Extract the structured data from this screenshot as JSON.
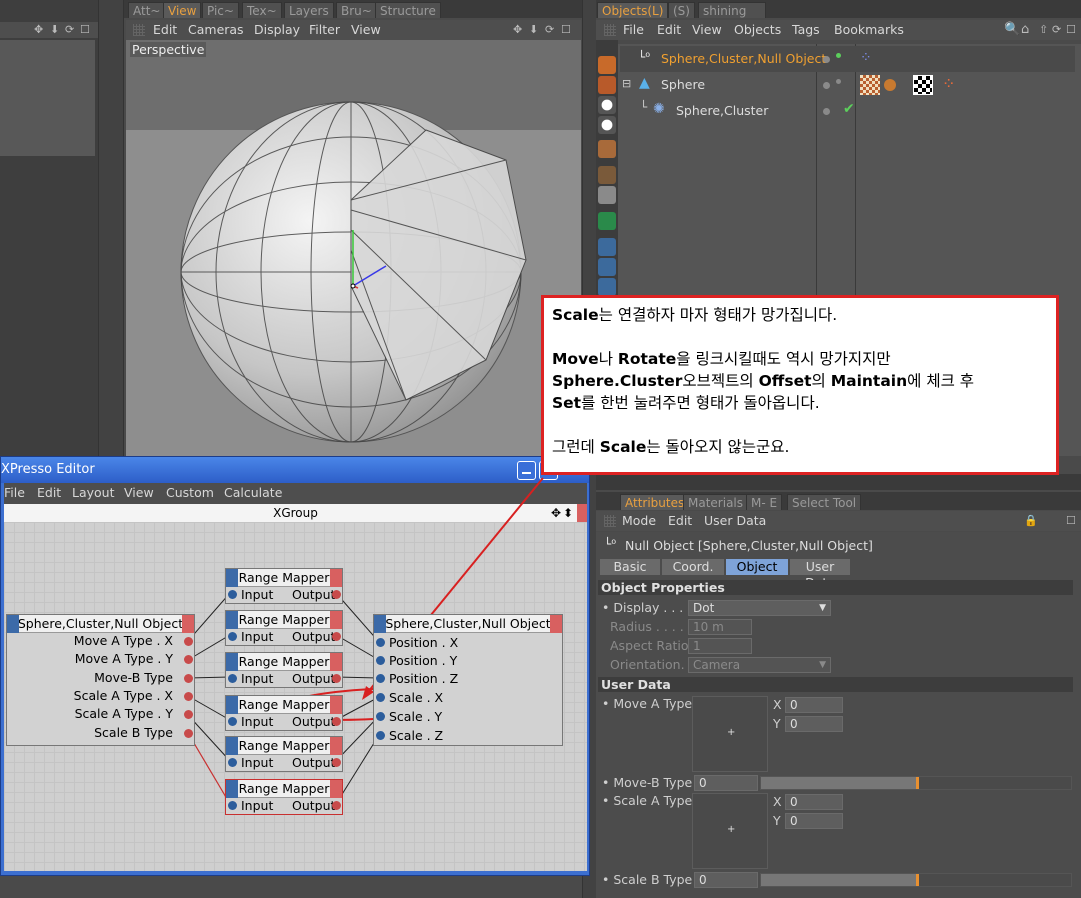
{
  "left_panel": {
    "tabs": [
      "Att~",
      "View",
      "Pic~",
      "Tex~",
      "Layers",
      "Bru~",
      "Structure"
    ],
    "active_tab": "View"
  },
  "viewport": {
    "menus": [
      "Edit",
      "Cameras",
      "Display",
      "Filter",
      "View"
    ],
    "label": "Perspective"
  },
  "object_manager": {
    "tabs": [
      "Objects(L)",
      "(S)",
      "shining"
    ],
    "menus": [
      "File",
      "Edit",
      "View",
      "Objects",
      "Tags",
      "Bookmarks"
    ],
    "objects": [
      {
        "name": "Sphere,Cluster,Null Object",
        "selected": true
      },
      {
        "name": "Sphere",
        "selected": false
      },
      {
        "name": "Sphere,Cluster",
        "selected": false
      }
    ]
  },
  "callout": {
    "line1": {
      "b1": "Scale",
      "t1": "는 연결하자 마자 형태가 망가집니다."
    },
    "line2": {
      "b1": "Move",
      "t1": "나 ",
      "b2": "Rotate",
      "t2": "을 링크시킬때도 역시 망가지지만"
    },
    "line3": {
      "b1": "Sphere.Cluster",
      "t1": "오브젝트의 ",
      "b2": "Offset",
      "t2": "의 ",
      "b3": "Maintain",
      "t3": "에 체크 후"
    },
    "line4": {
      "b1": "Set",
      "t1": "를 한번 눌려주면 형태가 돌아옵니다."
    },
    "line5": {
      "t0": "그런데 ",
      "b1": "Scale",
      "t1": "는 돌아오지 않는군요."
    }
  },
  "xpresso": {
    "title": "XPresso Editor",
    "menus": [
      "File",
      "Edit",
      "Layout",
      "View",
      "Custom",
      "Calculate"
    ],
    "group": "XGroup",
    "source_node": {
      "title": "Sphere,Cluster,Null Object",
      "ports": [
        "Move A Type . X",
        "Move A Type . Y",
        "Move-B Type",
        "Scale A Type . X",
        "Scale A Type . Y",
        "Scale B Type"
      ]
    },
    "mapper_nodes": [
      {
        "title": "Range Mapper",
        "in": "Input",
        "out": "Output"
      },
      {
        "title": "Range Mapper",
        "in": "Input",
        "out": "Output"
      },
      {
        "title": "Range Mapper",
        "in": "Input",
        "out": "Output"
      },
      {
        "title": "Range Mapper",
        "in": "Input",
        "out": "Output"
      },
      {
        "title": "Range Mapper",
        "in": "Input",
        "out": "Output"
      },
      {
        "title": "Range Mapper",
        "in": "Input",
        "out": "Output"
      }
    ],
    "target_node": {
      "title": "Sphere,Cluster,Null Object",
      "ports": [
        "Position . X",
        "Position . Y",
        "Position . Z",
        "Scale . X",
        "Scale . Y",
        "Scale . Z"
      ]
    }
  },
  "attributes": {
    "tabs": [
      "Attributes",
      "Materials",
      "M- E",
      "Select Tool"
    ],
    "menus": [
      "Mode",
      "Edit",
      "User Data"
    ],
    "object_title": "Null Object [Sphere,Cluster,Null Object]",
    "subtabs": [
      "Basic",
      "Coord.",
      "Object",
      "User Data"
    ],
    "active_subtab": "Object",
    "object_properties": {
      "header": "Object Properties",
      "display_label": "Display . . . . .",
      "display_value": "Dot",
      "radius_label": "Radius . . . . .",
      "radius_value": "10 m",
      "aspect_label": "Aspect Ratio",
      "aspect_value": "1",
      "orientation_label": "Orientation. .",
      "orientation_value": "Camera"
    },
    "user_data": {
      "header": "User Data",
      "move_a_label": "Move A Type",
      "move_a_x": "0",
      "move_a_y": "0",
      "move_b_label": "Move-B Type",
      "move_b_value": "0",
      "scale_a_label": "Scale A Type",
      "scale_a_x": "0",
      "scale_a_y": "0",
      "scale_b_label": "Scale B Type",
      "scale_b_value": "0",
      "x_axis": "X",
      "y_axis": "Y"
    }
  }
}
